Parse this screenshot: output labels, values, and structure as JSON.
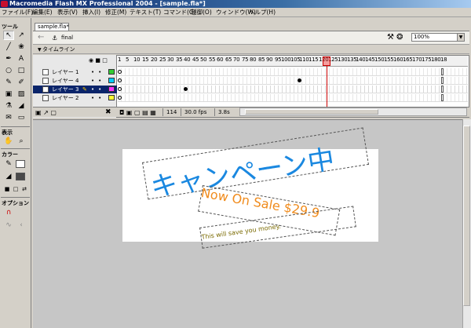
{
  "window": {
    "title": "Macromedia Flash MX Professional 2004 - [sample.fla*]"
  },
  "menu": [
    "ファイル(F)",
    "編集(E)",
    "表示(V)",
    "挿入(I)",
    "修正(M)",
    "テキスト(T)",
    "コマンド(C)",
    "制御(O)",
    "ウィンドウ(W)",
    "ヘルプ(H)"
  ],
  "toolbox": {
    "tools_label": "ツール",
    "view_label": "表示",
    "colors_label": "カラー",
    "options_label": "オプション"
  },
  "document": {
    "tab": "sample.fla*",
    "scene": "final",
    "zoom": "100%"
  },
  "timeline": {
    "label": "タイムライン",
    "ruler": [
      "1",
      "5",
      "10",
      "15",
      "20",
      "25",
      "30",
      "35",
      "40",
      "45",
      "50",
      "55",
      "60",
      "65",
      "70",
      "75",
      "80",
      "85",
      "90",
      "95",
      "100",
      "105",
      "110",
      "115",
      "120",
      "125",
      "130",
      "135",
      "140",
      "145",
      "150",
      "155",
      "160",
      "165",
      "170",
      "175",
      "180",
      "18"
    ],
    "layers": [
      {
        "name": "レイヤー 1",
        "color": "#33cc33",
        "selected": false
      },
      {
        "name": "レイヤー 4",
        "color": "#00ccff",
        "selected": false
      },
      {
        "name": "レイヤー 3",
        "color": "#ff33ff",
        "selected": true
      },
      {
        "name": "レイヤー 2",
        "color": "#ffff33",
        "selected": false
      }
    ],
    "current_frame": "114",
    "fps": "30.0 fps",
    "time": "3.8s"
  },
  "stage": {
    "title": "キャンペーン中",
    "sale": "Now On Sale $29.9",
    "save": "This will save you money."
  },
  "colors": {
    "title_blue": "#1a88e0",
    "sale_orange": "#f08c1e",
    "save_olive": "#7a6a00",
    "selection_blue": "#0a246a"
  }
}
